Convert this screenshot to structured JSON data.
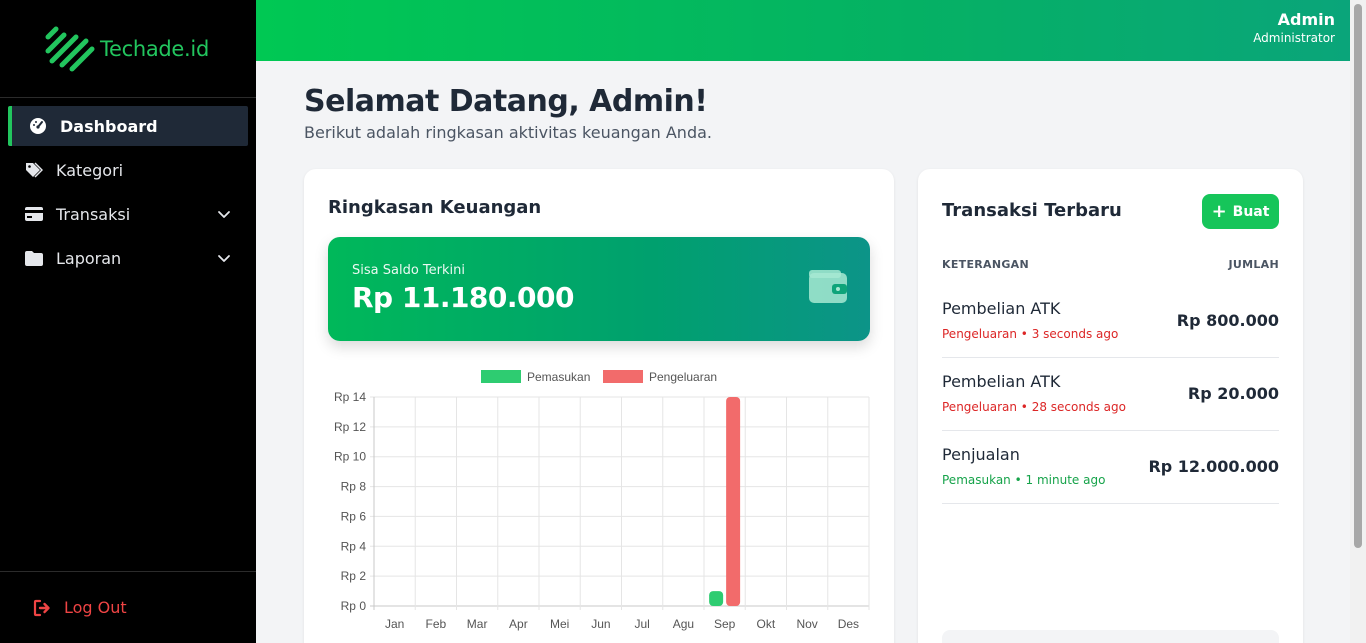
{
  "brand": {
    "name": "Techade.id",
    "accent": "#22c55e"
  },
  "sidebar": {
    "items": [
      {
        "label": "Dashboard",
        "icon": "gauge-icon",
        "active": true
      },
      {
        "label": "Kategori",
        "icon": "tag-icon",
        "active": false
      },
      {
        "label": "Transaksi",
        "icon": "credit-card-icon",
        "active": false,
        "expandable": true
      },
      {
        "label": "Laporan",
        "icon": "folder-icon",
        "active": false,
        "expandable": true
      }
    ],
    "logout": "Log Out"
  },
  "header": {
    "user_name": "Admin",
    "user_role": "Administrator"
  },
  "welcome": {
    "title": "Selamat Datang, Admin!",
    "subtitle": "Berikut adalah ringkasan aktivitas keuangan Anda."
  },
  "summary": {
    "title": "Ringkasan Keuangan",
    "balance_label": "Sisa Saldo Terkini",
    "balance_value": "Rp 11.180.000"
  },
  "recent": {
    "title": "Transaksi Terbaru",
    "create_label": "Buat",
    "col_left": "KETERANGAN",
    "col_right": "JUMLAH",
    "items": [
      {
        "name": "Pembelian ATK",
        "type": "Pengeluaran",
        "time": "3 seconds ago",
        "amount": "Rp 800.000"
      },
      {
        "name": "Pembelian ATK",
        "type": "Pengeluaran",
        "time": "28 seconds ago",
        "amount": "Rp 20.000"
      },
      {
        "name": "Penjualan",
        "type": "Pemasukan",
        "time": "1 minute ago",
        "amount": "Rp 12.000.000"
      }
    ]
  },
  "chart_data": {
    "type": "bar",
    "categories": [
      "Jan",
      "Feb",
      "Mar",
      "Apr",
      "Mei",
      "Jun",
      "Jul",
      "Agu",
      "Sep",
      "Okt",
      "Nov",
      "Des"
    ],
    "series": [
      {
        "name": "Pemasukan",
        "color": "#2ecc71",
        "values": [
          0,
          0,
          0,
          0,
          0,
          0,
          0,
          0,
          1,
          0,
          0,
          0
        ]
      },
      {
        "name": "Pengeluaran",
        "color": "#f26b6b",
        "values": [
          0,
          0,
          0,
          0,
          0,
          0,
          0,
          0,
          14,
          0,
          0,
          0
        ]
      }
    ],
    "yticks": [
      "Rp 0",
      "Rp 2",
      "Rp 4",
      "Rp 6",
      "Rp 8",
      "Rp 10",
      "Rp 12",
      "Rp 14"
    ],
    "ylim": [
      0,
      14
    ],
    "grid": true,
    "legend": "top-center"
  },
  "colors": {
    "income": "#16a34a",
    "expense": "#dc2626",
    "primary": "#16c55a"
  }
}
